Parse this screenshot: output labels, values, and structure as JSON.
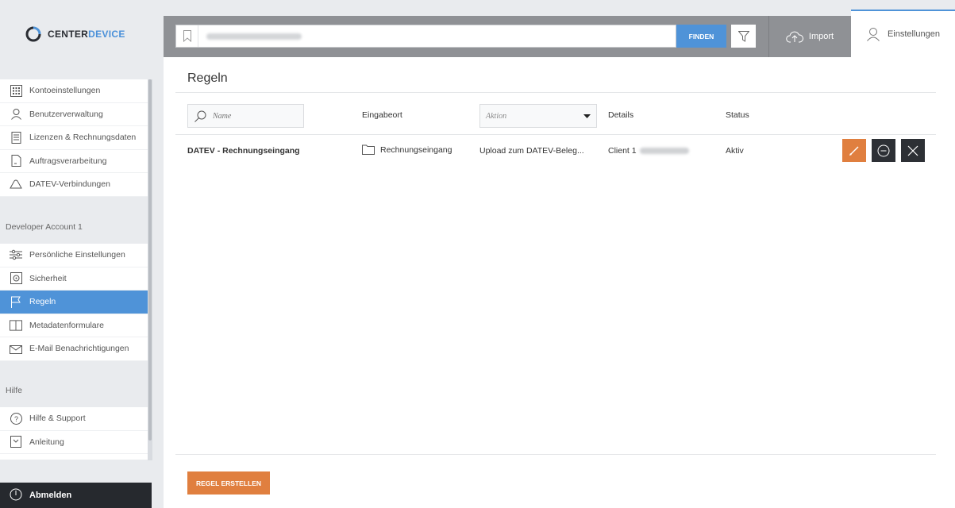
{
  "brand": {
    "name_part1": "CENTER",
    "name_part2": "DEVICE",
    "accent": "#4f93d8",
    "orange": "#e07f3f"
  },
  "search": {
    "placeholder": "",
    "find_label": "FINDEN"
  },
  "header": {
    "import_label": "Import",
    "settings_label": "Einstellungen"
  },
  "sidebar": {
    "account_items": [
      {
        "label": "Kontoeinstellungen",
        "icon": "grid-icon"
      },
      {
        "label": "Benutzerverwaltung",
        "icon": "user-icon"
      },
      {
        "label": "Lizenzen & Rechnungsdaten",
        "icon": "receipt-icon"
      },
      {
        "label": "Auftragsverarbeitung",
        "icon": "document-icon"
      },
      {
        "label": "DATEV-Verbindungen",
        "icon": "cloud-icon"
      }
    ],
    "developer_section": "Developer Account 1",
    "developer_items": [
      {
        "label": "Persönliche Einstellungen",
        "icon": "sliders-icon"
      },
      {
        "label": "Sicherheit",
        "icon": "safe-icon"
      },
      {
        "label": "Regeln",
        "icon": "flag-icon",
        "active": true
      },
      {
        "label": "Metadatenformulare",
        "icon": "book-icon"
      },
      {
        "label": "E-Mail Benachrichtigungen",
        "icon": "mail-icon"
      }
    ],
    "help_section": "Hilfe",
    "help_items": [
      {
        "label": "Hilfe & Support",
        "icon": "question-icon"
      },
      {
        "label": "Anleitung",
        "icon": "guide-icon"
      }
    ],
    "logout_label": "Abmelden"
  },
  "main": {
    "title": "Regeln",
    "filters": {
      "name_placeholder": "Name",
      "action_placeholder": "Aktion"
    },
    "columns": {
      "location": "Eingabeort",
      "details": "Details",
      "status": "Status"
    },
    "rows": [
      {
        "name": "DATEV - Rechnungseingang",
        "location": "Rechnungseingang",
        "action": "Upload zum DATEV-Beleg...",
        "details": "Client 1",
        "status": "Aktiv"
      }
    ],
    "create_label": "REGEL ERSTELLEN"
  }
}
